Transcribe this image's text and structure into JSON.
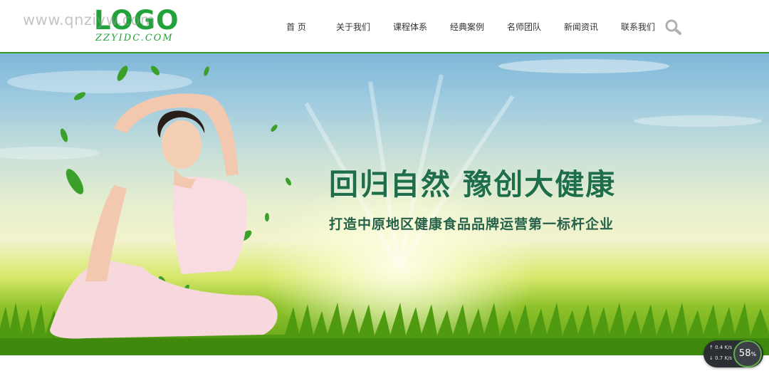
{
  "header": {
    "watermark": "www.qnziyw.com",
    "logo_main": "LOGO",
    "logo_sub": "ZZYIDC.COM",
    "nav": [
      {
        "label": "首 页"
      },
      {
        "label": "关于我们"
      },
      {
        "label": "课程体系"
      },
      {
        "label": "经典案例"
      },
      {
        "label": "名师团队"
      },
      {
        "label": "新闻资讯"
      },
      {
        "label": "联系我们"
      }
    ],
    "search_icon": "search-icon"
  },
  "banner": {
    "slogan_main": "回归自然  豫创大健康",
    "slogan_sub": "打造中原地区健康食品品牌运营第一标杆企业"
  },
  "speed_widget": {
    "up": "0.4",
    "down": "0.7",
    "unit": "K/s",
    "percent": "58",
    "percent_sign": "%"
  },
  "colors": {
    "brand_green": "#21a23a",
    "header_line": "#3a9a2a",
    "slogan": "#1f6e4a"
  }
}
